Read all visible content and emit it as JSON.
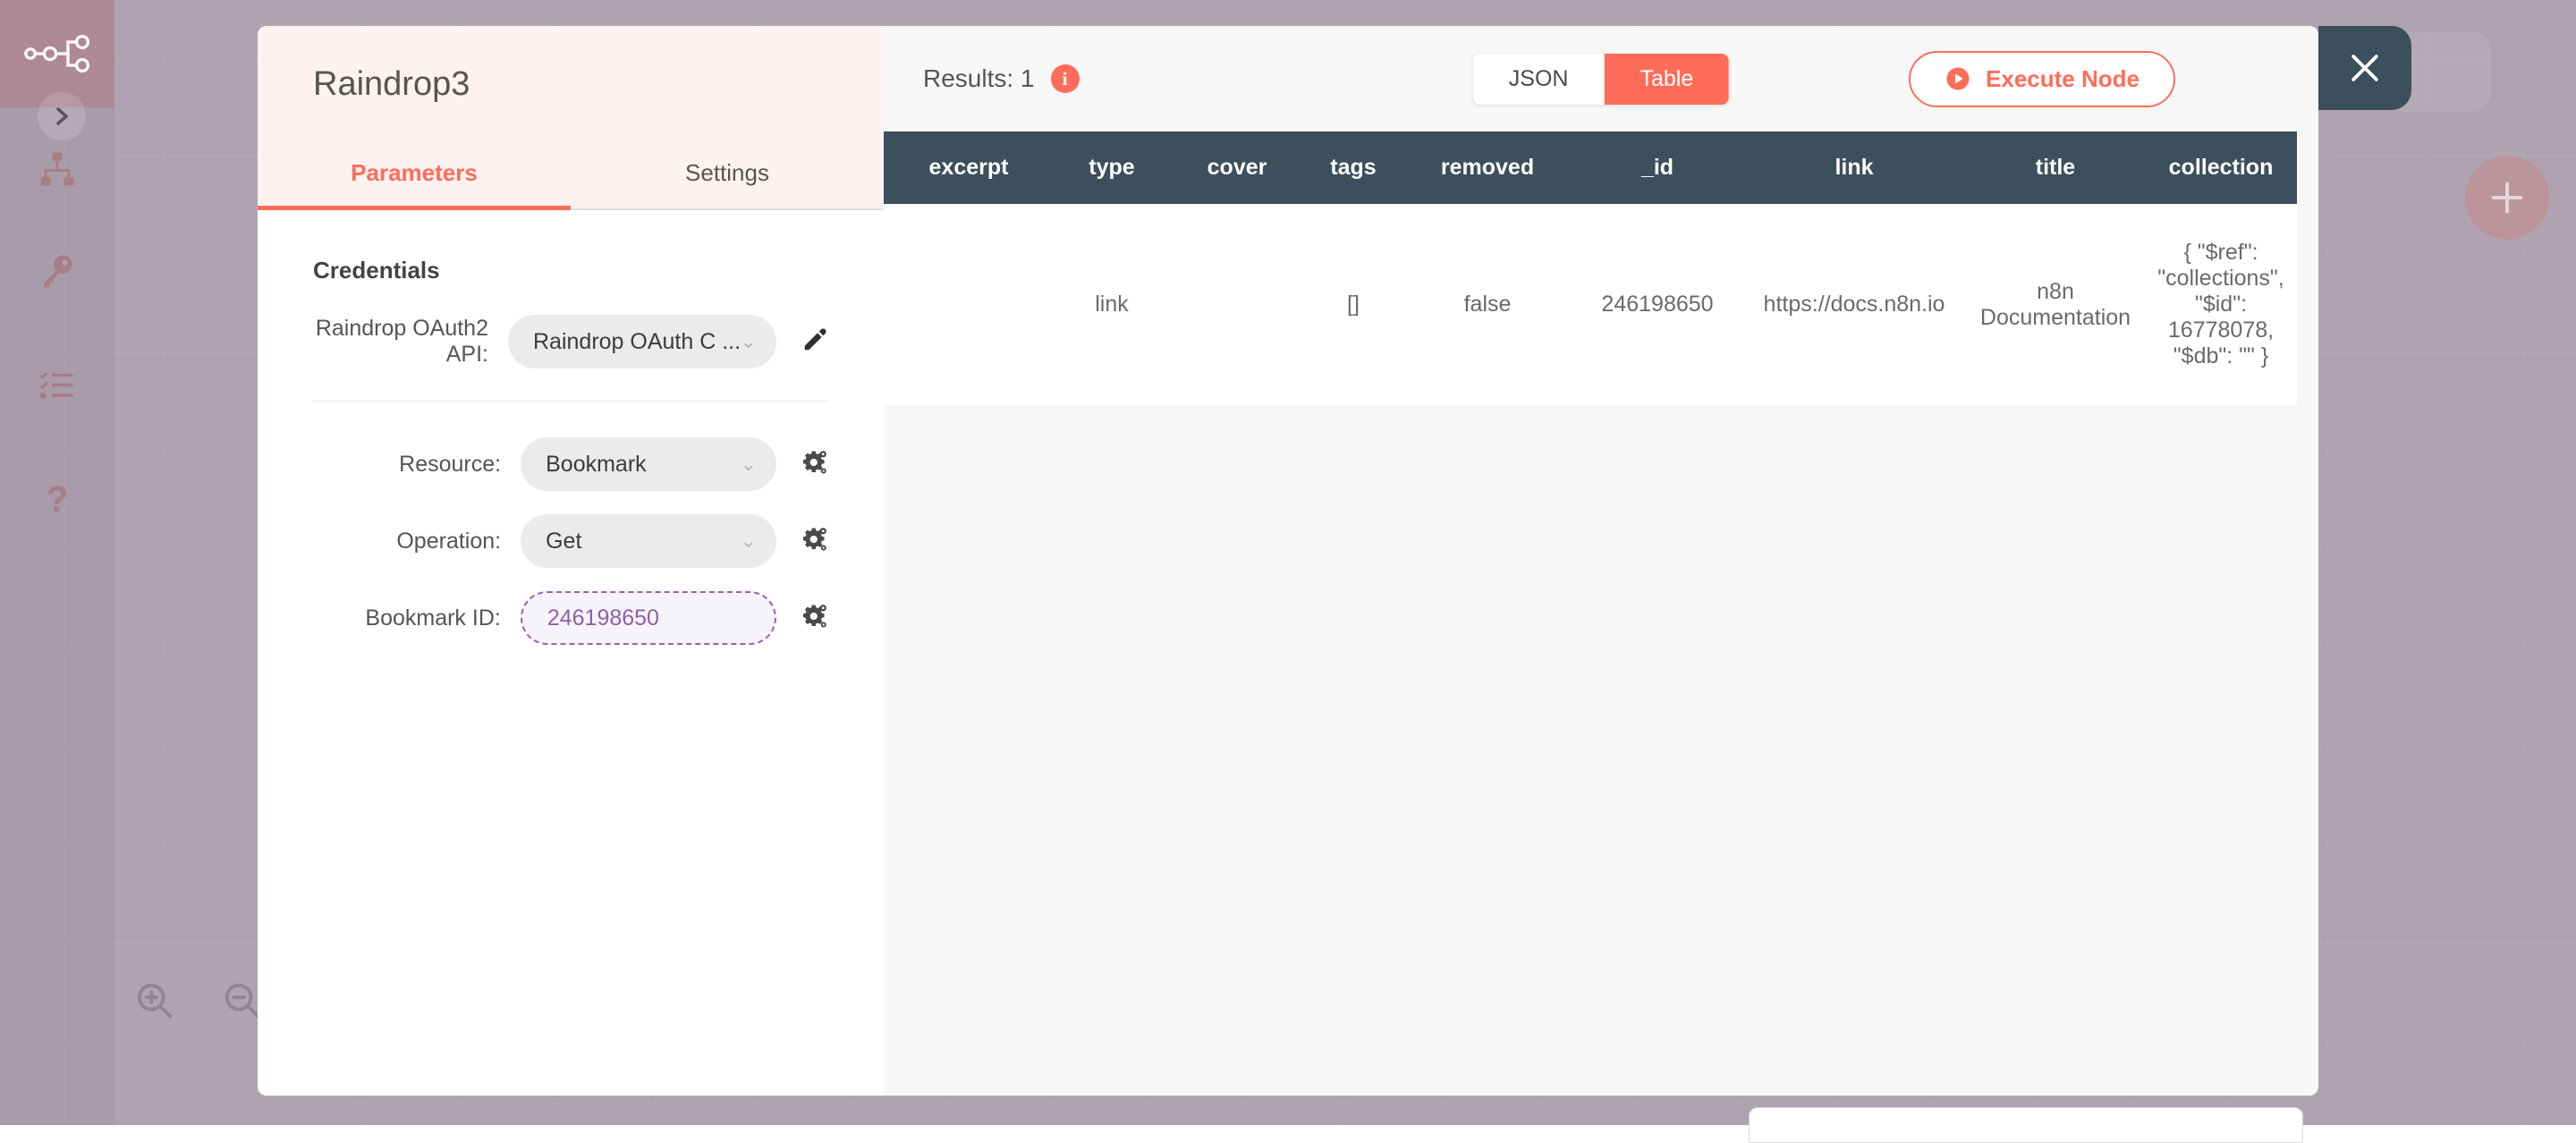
{
  "colors": {
    "accent": "#ff6d5a",
    "header_dark": "#3c4f5c",
    "canvas": "#b0a3b1",
    "expression_purple": "#8f5fa8",
    "panel_tint": "#fdf2ef"
  },
  "sidebar": {
    "items": [
      {
        "name": "n8n-logo",
        "icon": "n8n-logo-icon"
      },
      {
        "name": "expand-sidebar",
        "icon": "chevron-right-icon"
      },
      {
        "name": "workflows",
        "icon": "sitemap-icon"
      },
      {
        "name": "credentials",
        "icon": "key-icon"
      },
      {
        "name": "executions",
        "icon": "checklist-icon"
      },
      {
        "name": "help",
        "icon": "question-mark-icon"
      }
    ]
  },
  "canvas": {
    "zoom_in_icon": "zoom-in-icon",
    "zoom_out_icon": "zoom-out-icon",
    "add_node_icon": "plus-icon"
  },
  "node_detail": {
    "title": "Raindrop3",
    "tabs": [
      {
        "label": "Parameters",
        "active": true
      },
      {
        "label": "Settings",
        "active": false
      }
    ],
    "credentials": {
      "heading": "Credentials",
      "label": "Raindrop OAuth2 API:",
      "value": "Raindrop OAuth C ...",
      "edit_icon": "pencil-icon"
    },
    "parameters": [
      {
        "label": "Resource:",
        "value": "Bookmark",
        "type": "select",
        "options_icon": "gear-icon"
      },
      {
        "label": "Operation:",
        "value": "Get",
        "type": "select",
        "options_icon": "gear-icon"
      },
      {
        "label": "Bookmark ID:",
        "value": "246198650",
        "type": "expression",
        "options_icon": "gear-icon"
      }
    ]
  },
  "results": {
    "count_label": "Results: 1",
    "info_icon": "info-icon",
    "view_modes": [
      {
        "label": "JSON",
        "active": false
      },
      {
        "label": "Table",
        "active": true
      }
    ],
    "execute_label": "Execute Node",
    "execute_icon": "play-icon",
    "close_icon": "close-icon",
    "table": {
      "columns": [
        "excerpt",
        "type",
        "cover",
        "tags",
        "removed",
        "_id",
        "link",
        "title",
        "collection"
      ],
      "rows": [
        {
          "excerpt": "",
          "type": "link",
          "cover": "",
          "tags": "[]",
          "removed": "false",
          "_id": "246198650",
          "link": "https://docs.n8n.io",
          "title": "n8n Documentation",
          "collection": "{ \"$ref\": \"collections\", \"$id\": 16778078, \"$db\": \"\" }"
        }
      ]
    }
  }
}
